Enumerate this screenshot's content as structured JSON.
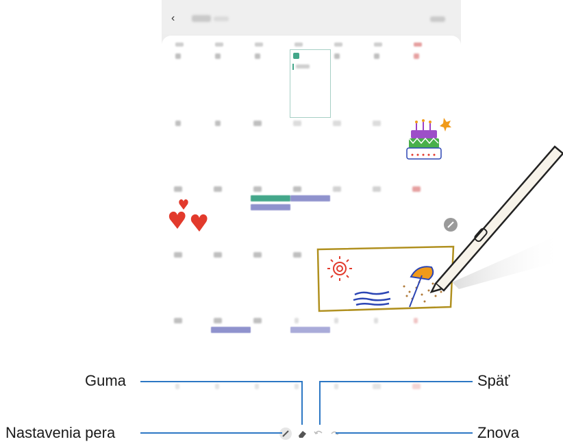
{
  "callouts": {
    "eraser": "Guma",
    "pen_settings": "Nastavenia pera",
    "undo": "Späť",
    "redo": "Znova"
  },
  "colors": {
    "callout_line": "#2c77c4",
    "event_green": "#43a78a",
    "event_purple": "#8f92cd",
    "sticky_border": "#a5cfc4",
    "doodle_frame": "#b0901f"
  },
  "icons": [
    "back-icon",
    "pen-icon",
    "eraser-icon",
    "undo-icon",
    "redo-icon",
    "edit-pen-icon"
  ]
}
